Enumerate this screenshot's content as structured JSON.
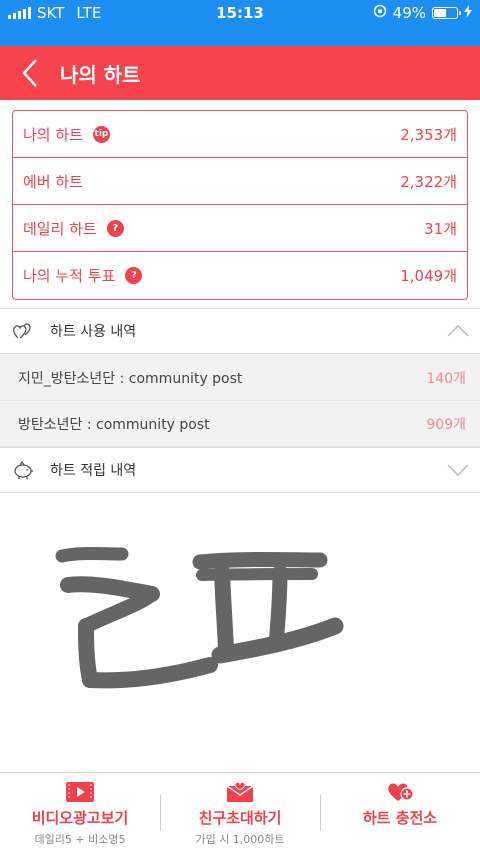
{
  "status_bar": {
    "carrier": "SKT",
    "network": "LTE",
    "time": "15:13",
    "battery": "49%",
    "battery_level": 0.49
  },
  "header": {
    "title": "나의 하트"
  },
  "stats": [
    {
      "label": "나의 하트",
      "badge": "tip",
      "value": "2,353개"
    },
    {
      "label": "에버 하트",
      "badge": "",
      "value": "2,322개"
    },
    {
      "label": "데일리 하트",
      "badge": "?",
      "value": "31개"
    },
    {
      "label": "나의 누적 투표",
      "badge": "?",
      "value": "1,049개"
    }
  ],
  "usage_section": {
    "title": "하트 사용 내역"
  },
  "usage_items": [
    {
      "name": "지민_방탄소년단 : community post",
      "count": "140개"
    },
    {
      "name": "방탄소년단 : community post",
      "count": "909개"
    }
  ],
  "earn_section": {
    "title": "하트 적립 내역"
  },
  "bottom_bar": {
    "video": {
      "label": "비디오광고보기",
      "sub": "데일리5 + 비소명5"
    },
    "invite": {
      "label": "친구초대하기",
      "sub": "가입 시 1,000하트"
    },
    "charge": {
      "label": "하트 충전소"
    }
  },
  "colors": {
    "accent": "#f7434b",
    "status_bar": "#1e8ff2"
  }
}
